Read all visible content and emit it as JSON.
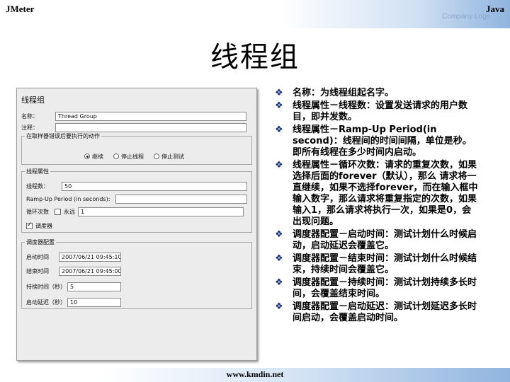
{
  "header": {
    "left": "JMeter",
    "right": "Java",
    "sub": "Company Logo"
  },
  "slide_title": "线程组",
  "panel": {
    "title": "线程组",
    "name_label": "名称：",
    "name_value": "Thread Group",
    "comment_label": "注释：",
    "comment_value": "",
    "error_group": {
      "legend": "在取样器错误后要执行的动作",
      "options": [
        "继续",
        "停止线程",
        "停止测试"
      ],
      "selected": 0
    },
    "thread_group": {
      "legend": "线程属性",
      "threads_label": "线程数：",
      "threads_value": "50",
      "ramp_label": "Ramp-Up Period (in seconds):",
      "ramp_value": "",
      "loop_label": "循环次数",
      "loop_forever_label": "永远",
      "loop_forever_checked": false,
      "loop_value": "1",
      "scheduler_label": "调度器",
      "scheduler_checked": true
    },
    "scheduler": {
      "legend": "调度器配置",
      "start_label": "启动时间",
      "start_value": "2007/06/21 09:45:10",
      "end_label": "结束时间",
      "end_value": "2007/06/21 09:45:00",
      "duration_label": "持续时间（秒）",
      "duration_value": "5",
      "delay_label": "启动延迟（秒）",
      "delay_value": "10"
    }
  },
  "bullets": [
    "名称：为线程组起名字。",
    "线程属性－线程数：设置发送请求的用户数目，即并发数。",
    "线程属性－Ramp-Up Period(in second)：线程间的时间间隔，单位是秒。即所有线程在多少时间内启动。",
    "线程属性－循环次数：请求的重复次数，如果选择后面的forever（默认），那么 请求将一直继续，如果不选择forever，而在输入框中输入数字，那么请求将重复指定的次数，如果输入1，那么请求将执行一次，如果是0，会出现问题。",
    "调度器配置－启动时间：测试计划什么时候启动，启动延迟会覆盖它。",
    "调度器配置－结束时间：测试计划什么时候结束，持续时间会覆盖它。",
    "调度器配置－持续时间：测试计划持续多长时间，会覆盖结束时间。",
    "调度器配置－启动延迟：测试计划延迟多长时间启动，会覆盖启动时间。"
  ],
  "bullet_marker": "❖",
  "footer": "www.kmdin.net"
}
